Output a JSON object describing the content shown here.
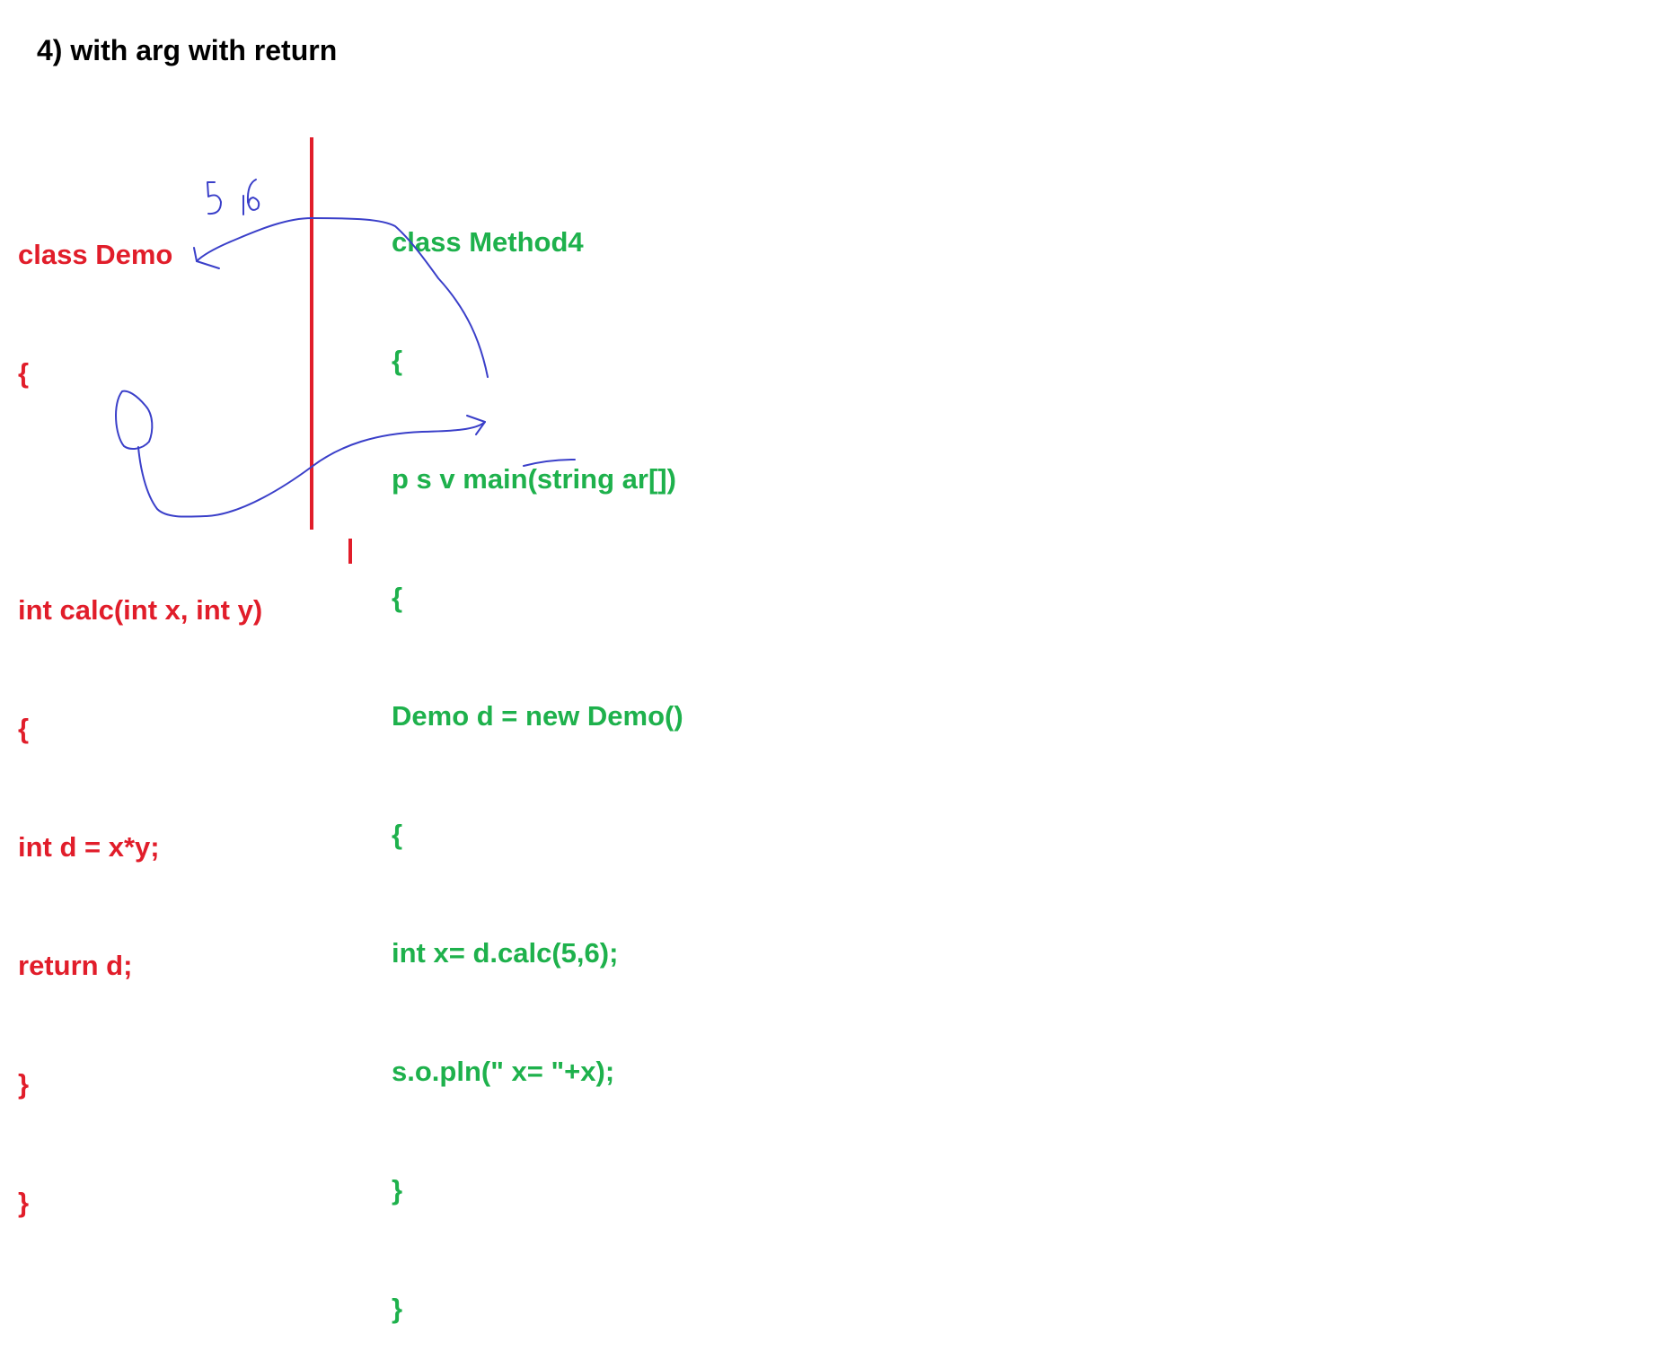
{
  "title": "4) with arg with return",
  "left_code": [
    "class Demo",
    "{",
    "",
    "int calc(int x, int y)",
    "{",
    "int d = x*y;",
    "return d;",
    "}",
    "}"
  ],
  "right_code": [
    "class Method4",
    "{",
    "p s v main(string ar[])",
    "{",
    "Demo d = new Demo()",
    "{",
    "int x= d.calc(5,6);",
    "s.o.pln(\" x= \"+x);",
    "}",
    "}"
  ],
  "annotation": "5 6",
  "colors": {
    "left_code": "#e11d2a",
    "right_code": "#1eb14c",
    "divider": "#e11d2a",
    "ink": "#3a3fc9",
    "title": "#000000"
  }
}
